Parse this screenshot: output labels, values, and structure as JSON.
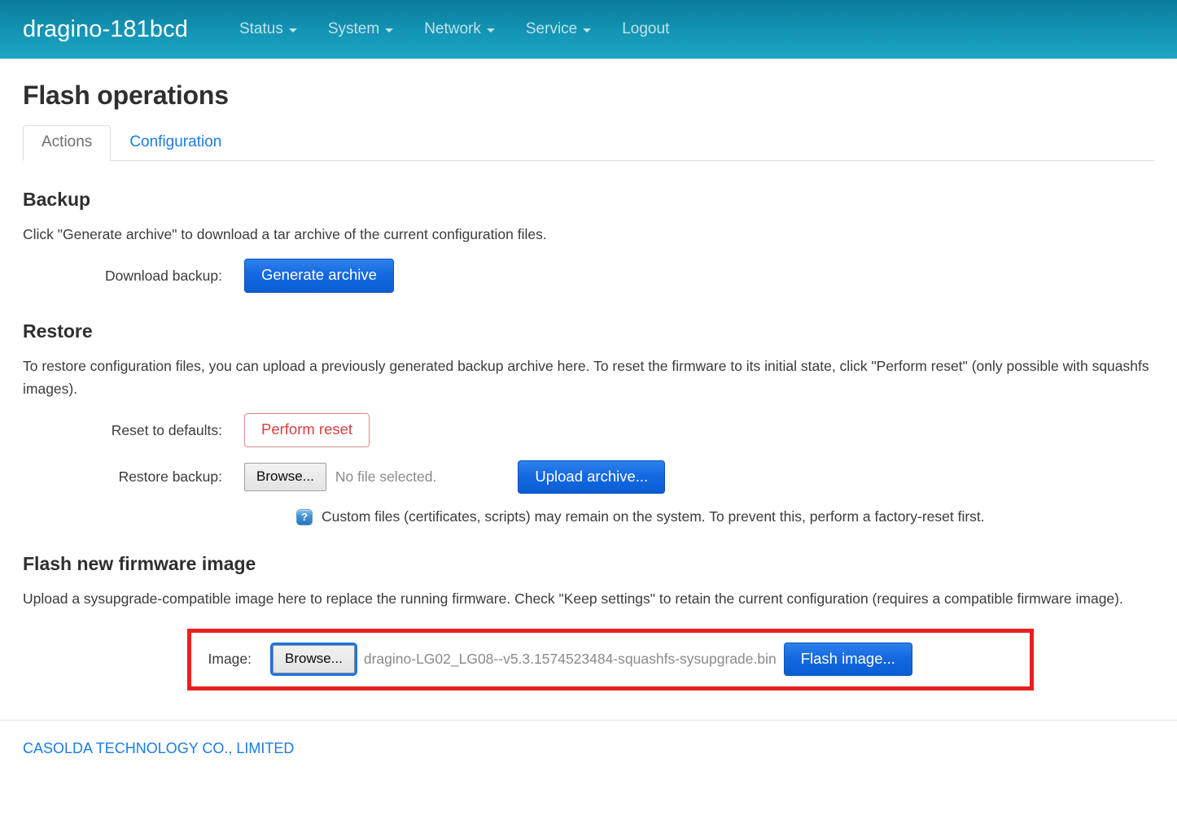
{
  "header": {
    "brand": "dragino-181bcd",
    "nav": [
      {
        "label": "Status",
        "has_caret": true
      },
      {
        "label": "System",
        "has_caret": true
      },
      {
        "label": "Network",
        "has_caret": true
      },
      {
        "label": "Service",
        "has_caret": true
      },
      {
        "label": "Logout",
        "has_caret": false
      }
    ]
  },
  "page": {
    "title": "Flash operations",
    "tabs": [
      {
        "label": "Actions",
        "active": true
      },
      {
        "label": "Configuration",
        "active": false
      }
    ]
  },
  "backup": {
    "heading": "Backup",
    "description": "Click \"Generate archive\" to download a tar archive of the current configuration files.",
    "download_label": "Download backup:",
    "generate_button": "Generate archive"
  },
  "restore": {
    "heading": "Restore",
    "description": "To restore configuration files, you can upload a previously generated backup archive here. To reset the firmware to its initial state, click \"Perform reset\" (only possible with squashfs images).",
    "reset_label": "Reset to defaults:",
    "reset_button": "Perform reset",
    "restore_label": "Restore backup:",
    "browse_button": "Browse...",
    "file_status": "No file selected.",
    "upload_button": "Upload archive...",
    "help_icon": "help-question-icon",
    "help_note": "Custom files (certificates, scripts) may remain on the system. To prevent this, perform a factory-reset first."
  },
  "flash": {
    "heading": "Flash new firmware image",
    "description": "Upload a sysupgrade-compatible image here to replace the running firmware. Check \"Keep settings\" to retain the current configuration (requires a compatible firmware image).",
    "image_label": "Image:",
    "browse_button": "Browse...",
    "selected_file": "dragino-LG02_LG08--v5.3.1574523484-squashfs-sysupgrade.bin",
    "flash_button": "Flash image..."
  },
  "footer": {
    "company": "CASOLDA TECHNOLOGY CO., LIMITED"
  },
  "colors": {
    "header_gradient_top": "#0c7c9b",
    "header_gradient_bottom": "#20a6c4",
    "primary_button": "#1468e0",
    "danger_text": "#d9413f",
    "link": "#1a7ce8",
    "highlight_border": "#e8201e"
  }
}
